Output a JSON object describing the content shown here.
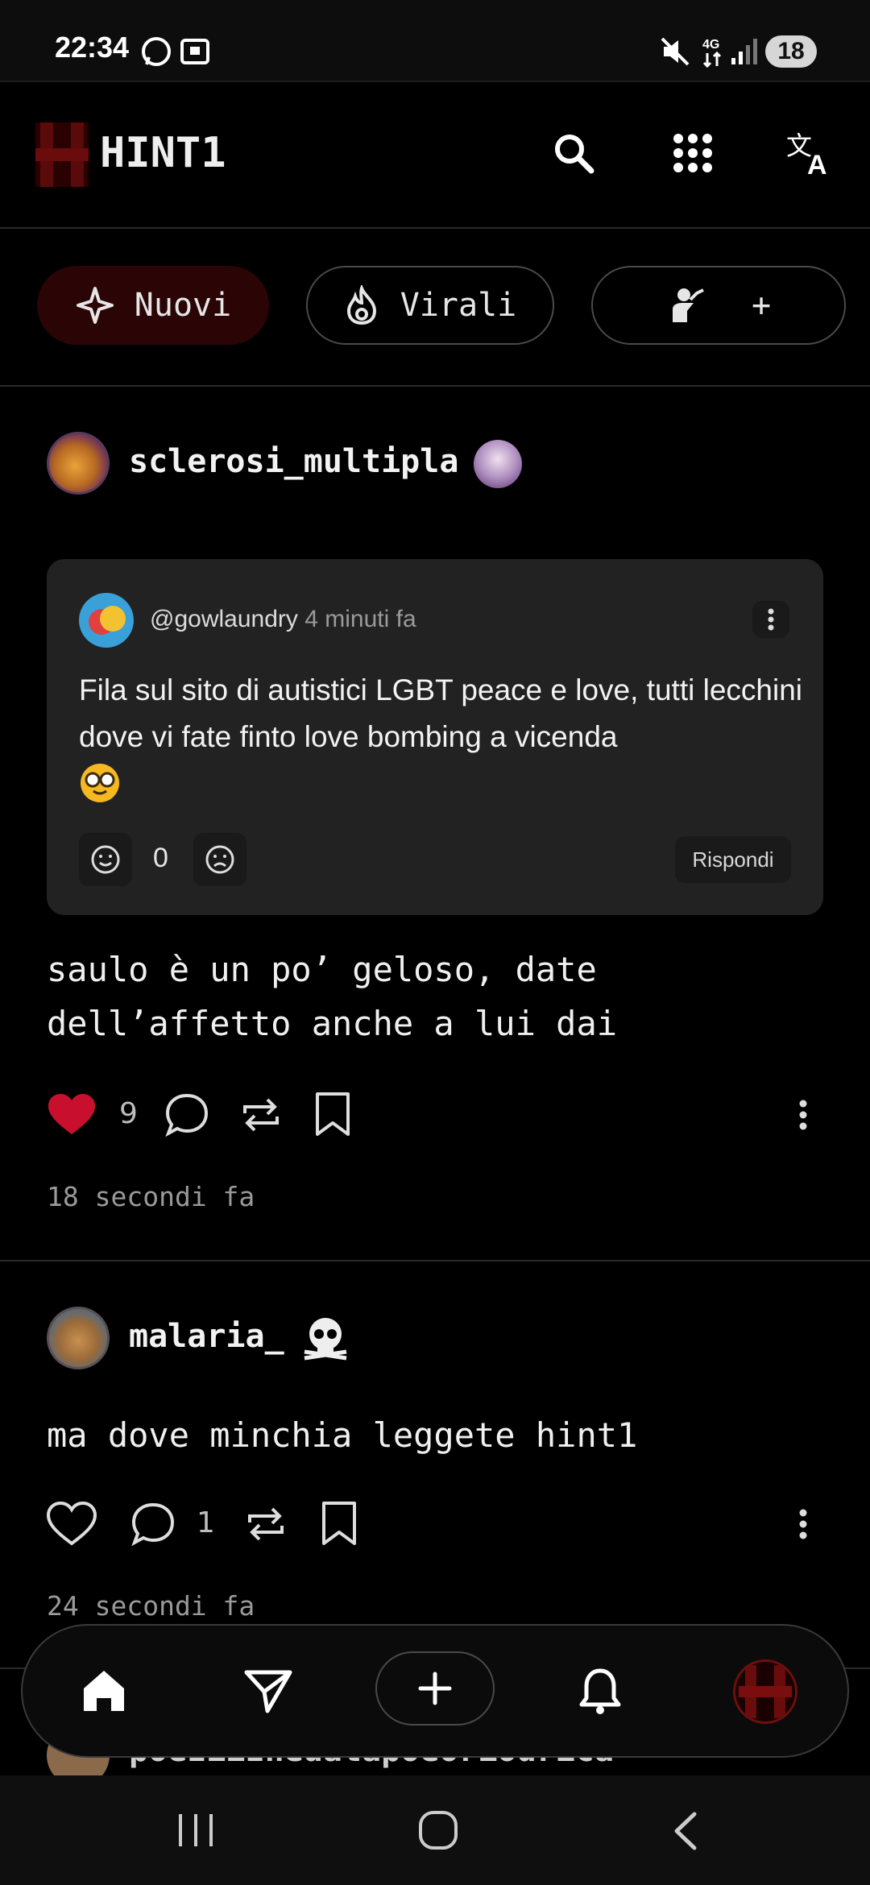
{
  "status_bar": {
    "time": "22:34",
    "battery": "18"
  },
  "header": {
    "title": "HINT1"
  },
  "chips": {
    "new_label": "Nuovi",
    "viral_label": "Virali",
    "add_label": "+"
  },
  "posts": [
    {
      "username": "sclerosi_multipla",
      "quote": {
        "user": "@gowlaundry",
        "time": "4 minuti fa",
        "text": "Fila sul sito di autistici LGBT peace e love, tutti lecchini dove vi fate finto love bombing a vicenda",
        "score": "0",
        "reply_label": "Rispondi"
      },
      "text_line1": "saulo è un po’ geloso, date",
      "text_line2": "dell’affetto anche a lui dai",
      "likes": "9",
      "time": "18 secondi fa"
    },
    {
      "username": "malaria_",
      "text_line1": "ma dove minchia leggete hint1",
      "comments": "1",
      "time": "24 secondi fa"
    },
    {
      "username": "poeziiznedatapoeoriodrica"
    }
  ],
  "colors": {
    "accent": "#c8102e",
    "background": "#000000",
    "card": "#222222"
  }
}
